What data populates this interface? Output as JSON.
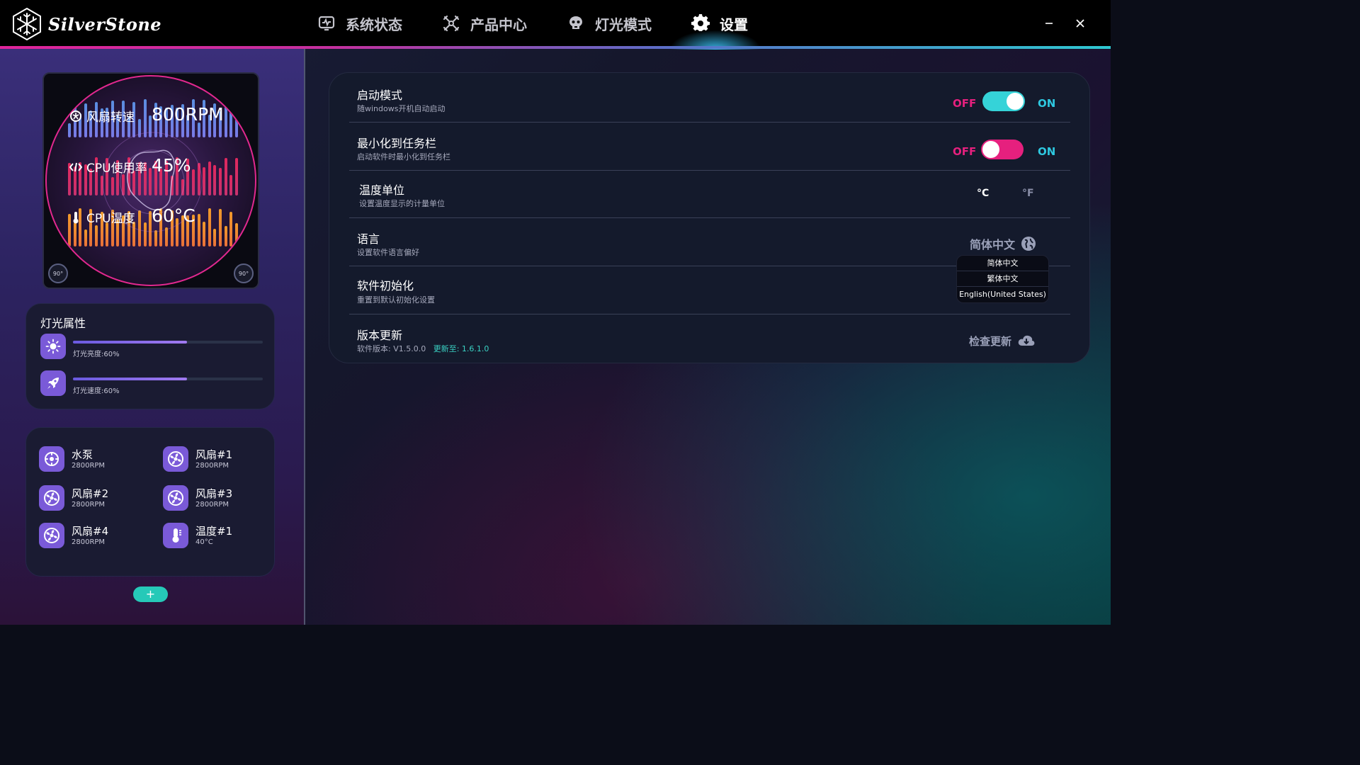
{
  "app": {
    "brand": "SilverStone"
  },
  "nav": {
    "items": [
      {
        "label": "系统状态",
        "icon": "monitor-icon"
      },
      {
        "label": "产品中心",
        "icon": "fan-product-icon"
      },
      {
        "label": "灯光模式",
        "icon": "light-mode-icon"
      },
      {
        "label": "设置",
        "icon": "gear-icon",
        "active": true
      }
    ]
  },
  "preview": {
    "metrics": [
      {
        "label": "风扇转速",
        "value": "800RPM",
        "icon": "fan-icon"
      },
      {
        "label": "CPU使用率",
        "value": "45%",
        "icon": "code-icon"
      },
      {
        "label": "CPU温度",
        "value": "60°C",
        "icon": "thermometer-icon"
      }
    ],
    "rotate_badges": [
      "90°",
      "90°"
    ]
  },
  "light_props": {
    "title": "灯光属性",
    "brightness": {
      "label": "灯光亮度:60%",
      "level": 0.6
    },
    "speed": {
      "label": "灯光速度:60%",
      "level": 0.6
    }
  },
  "devices": [
    {
      "name": "水泵",
      "value": "2800RPM",
      "icon": "pump-icon"
    },
    {
      "name": "风扇#1",
      "value": "2800RPM",
      "icon": "fan-icon"
    },
    {
      "name": "风扇#2",
      "value": "2800RPM",
      "icon": "fan-icon"
    },
    {
      "name": "风扇#3",
      "value": "2800RPM",
      "icon": "fan-icon"
    },
    {
      "name": "风扇#4",
      "value": "2800RPM",
      "icon": "fan-icon"
    },
    {
      "name": "温度#1",
      "value": "40°C",
      "icon": "thermometer-icon"
    }
  ],
  "add_button": "+",
  "settings": {
    "startup": {
      "title": "启动模式",
      "desc": "随windows开机自动启动",
      "off": "OFF",
      "on": "ON",
      "enabled": true
    },
    "minimize": {
      "title": "最小化到任务栏",
      "desc": "启动软件时最小化到任务栏",
      "off": "OFF",
      "on": "ON",
      "enabled": false
    },
    "temp_unit": {
      "title": "温度单位",
      "desc": "设置温度显示的计量单位",
      "celsius": "°C",
      "fahrenheit": "°F",
      "selected": "°C"
    },
    "language": {
      "title": "语言",
      "desc": "设置软件语言偏好",
      "current": "简体中文",
      "options": [
        "简体中文",
        "繁体中文",
        "English(United States)"
      ]
    },
    "reset": {
      "title": "软件初始化",
      "desc": "重置到默认初始化设置"
    },
    "update": {
      "title": "版本更新",
      "desc": "软件版本: V1.5.0.0",
      "update_to": "更新至: 1.6.1.0",
      "button": "检查更新"
    }
  },
  "colors": {
    "accent_pink": "#e6207e",
    "accent_cyan": "#2ec8e0",
    "accent_purple": "#7a5ad8",
    "teal": "#26c9b8"
  }
}
